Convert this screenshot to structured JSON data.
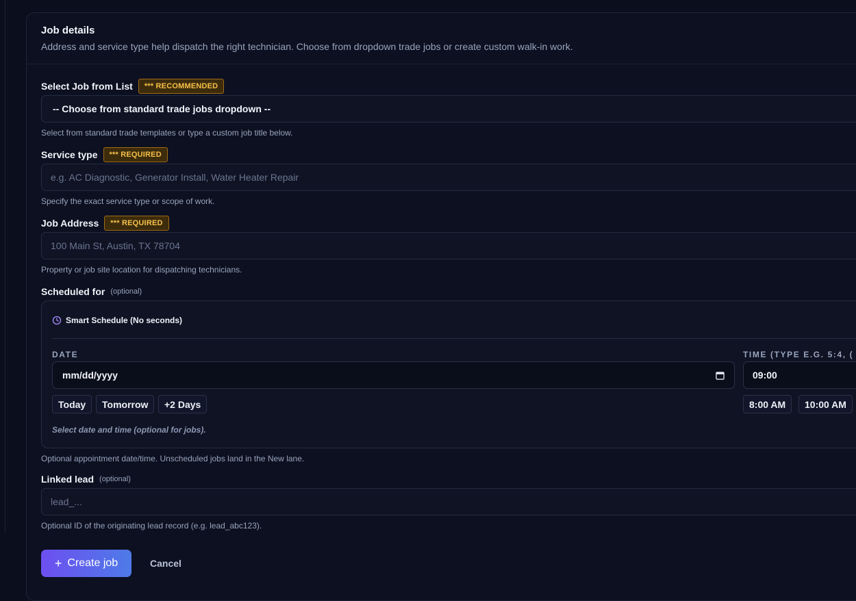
{
  "card": {
    "title": "Job details",
    "subtitle": "Address and service type help dispatch the right technician. Choose from dropdown trade jobs or create custom walk-in work."
  },
  "job_select": {
    "label": "Select Job from List",
    "badge": "*** RECOMMENDED",
    "value": "-- Choose from standard trade jobs dropdown --",
    "help": "Select from standard trade templates or type a custom job title below."
  },
  "service_type": {
    "label": "Service type",
    "badge": "*** REQUIRED",
    "placeholder": "e.g. AC Diagnostic, Generator Install, Water Heater Repair",
    "help": "Specify the exact service type or scope of work."
  },
  "job_address": {
    "label": "Job Address",
    "badge": "*** REQUIRED",
    "placeholder": "100 Main St, Austin, TX 78704",
    "help": "Property or job site location for dispatching technicians."
  },
  "scheduled": {
    "label": "Scheduled for",
    "optional": "(optional)",
    "box_title": "Smart Schedule (No seconds)",
    "date_label": "DATE",
    "date_value": "mm/dd/yyyy",
    "time_label": "TIME (TYPE E.G. 5:4, (",
    "time_value": "09:00",
    "date_chips": [
      "Today",
      "Tomorrow",
      "+2 Days"
    ],
    "time_chips": [
      "8:00 AM",
      "10:00 AM"
    ],
    "note": "Select date and time (optional for jobs).",
    "help": "Optional appointment date/time. Unscheduled jobs land in the New lane."
  },
  "linked_lead": {
    "label": "Linked lead",
    "optional": "(optional)",
    "placeholder": "lead_...",
    "help": "Optional ID of the originating lead record (e.g. lead_abc123)."
  },
  "actions": {
    "create_label": "Create job",
    "cancel_label": "Cancel"
  },
  "icons": {
    "schedule": "clock-icon",
    "date": "calendar-icon",
    "create": "plus-icon"
  },
  "colors": {
    "accent_start": "#6d4ff0",
    "accent_end": "#4e7be8",
    "badge_text": "#f6c14a",
    "clock_icon": "#a78bfa"
  }
}
